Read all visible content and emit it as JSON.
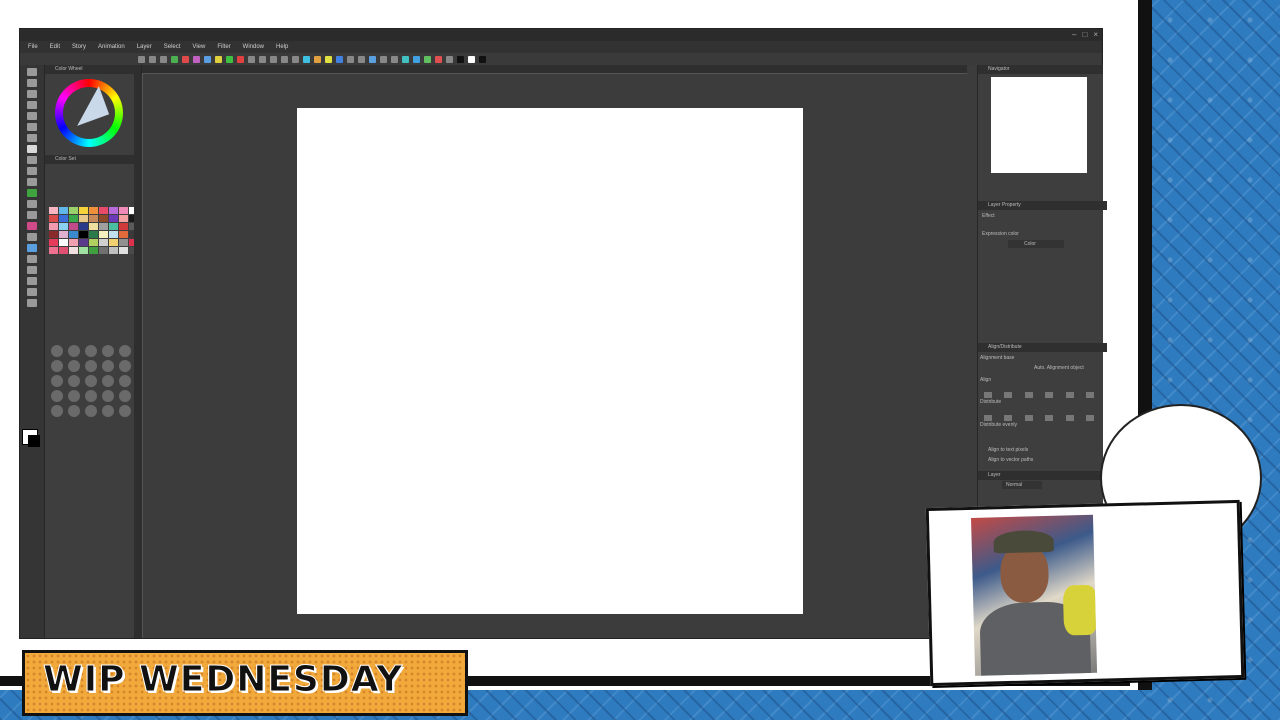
{
  "app": {
    "menu": [
      "File",
      "Edit",
      "Story",
      "Animation",
      "Layer",
      "Select",
      "View",
      "Filter",
      "Window",
      "Help"
    ]
  },
  "left_panel": {
    "color_wheel_tab": "Color Wheel",
    "color_set_tab": "Color Set"
  },
  "right_panel": {
    "navigator_tab": "Navigator",
    "layer_property_tab": "Layer Property",
    "effect_label": "Effect",
    "expression_color_label": "Expression color",
    "expression_color_value": "Color",
    "align_distribute_tab": "Align/Distribute",
    "alignment_base_label": "Alignment base",
    "auto_alignment_label": "Auto. Alignment object",
    "align_label": "Align",
    "distribute_label": "Distribute",
    "distribute_evenly_label": "Distribute evenly",
    "align_to_text_checkbox": "Align to text pixels",
    "align_to_vector_checkbox": "Align to vector paths",
    "layer_tab": "Layer",
    "blend_mode": "Normal"
  },
  "overlay": {
    "banner_text": "WIP WEDNESDAY"
  },
  "colors": {
    "banner": "#f2a93b",
    "frame_blue": "#2f7bbf",
    "app_dark": "#3c3c3c"
  }
}
